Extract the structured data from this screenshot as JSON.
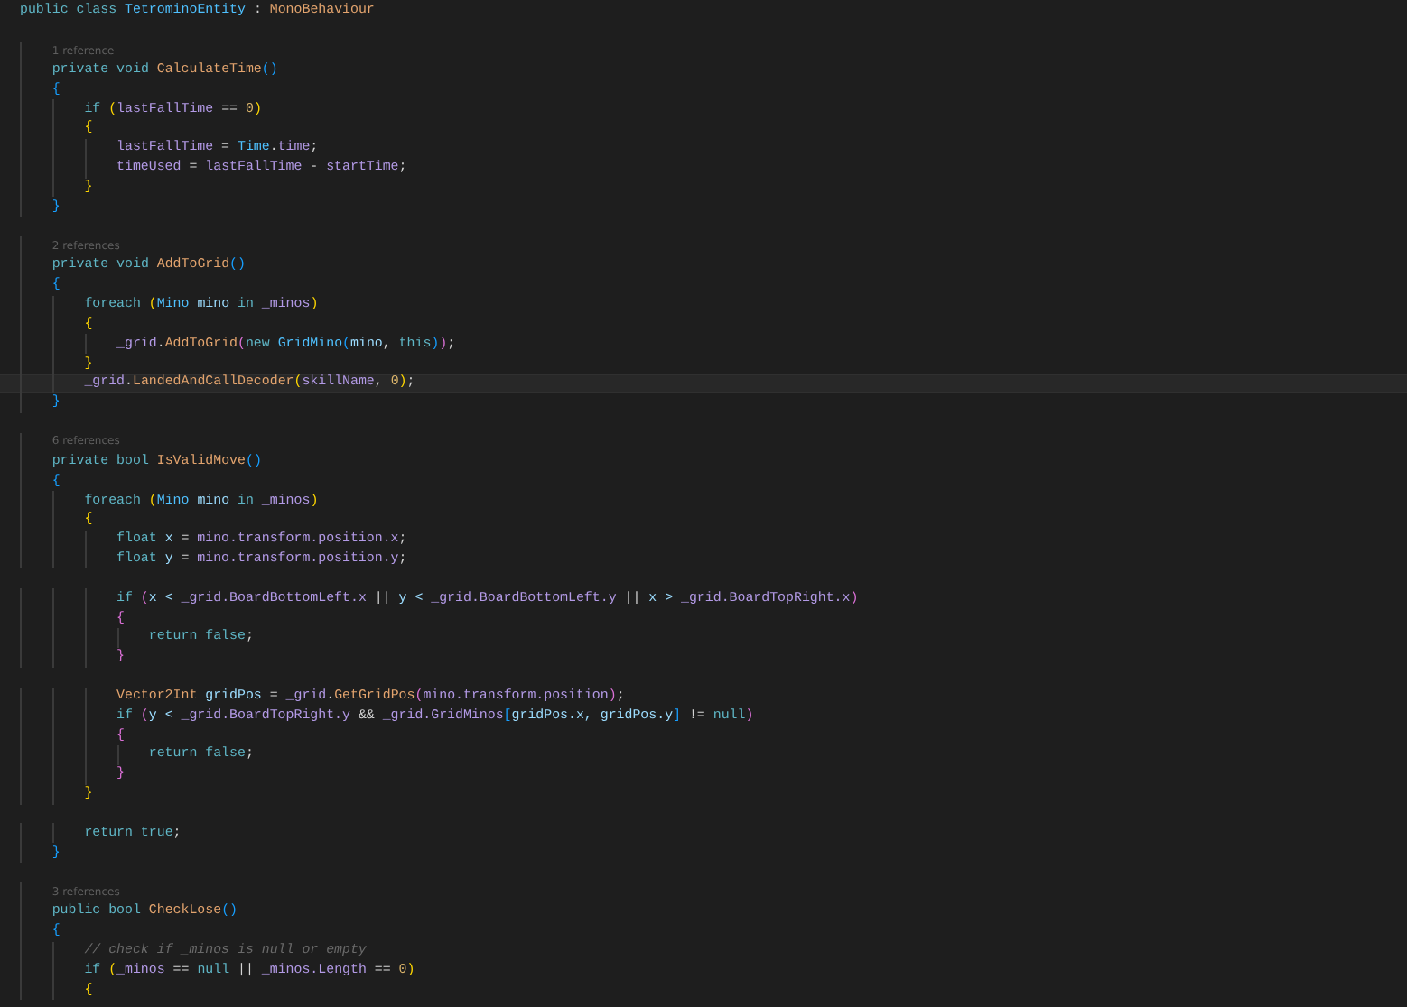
{
  "lines": [
    {
      "kind": "code",
      "tokens": [
        {
          "text": "public class ",
          "kind": "keyword"
        },
        {
          "text": "TetrominoEntity",
          "kind": "class"
        },
        {
          "text": " : ",
          "kind": "plain"
        },
        {
          "text": "MonoBehaviour",
          "kind": "base"
        }
      ],
      "children": [
        {
          "kind": "blank"
        },
        {
          "kind": "codelens",
          "text": "1 reference"
        },
        {
          "kind": "code",
          "tokens": [
            {
              "text": "private void ",
              "kind": "keyword"
            },
            {
              "text": "CalculateTime",
              "kind": "method"
            },
            {
              "text": "()",
              "kind": "bracket3"
            }
          ]
        },
        {
          "kind": "code",
          "tokens": [
            {
              "text": "{",
              "kind": "bracket3"
            }
          ],
          "children": [
            {
              "kind": "code",
              "tokens": [
                {
                  "text": "if ",
                  "kind": "keyword"
                },
                {
                  "text": "(",
                  "kind": "bracket1"
                },
                {
                  "text": "lastFallTime",
                  "kind": "field"
                },
                {
                  "text": " == ",
                  "kind": "plain"
                },
                {
                  "text": "0",
                  "kind": "number"
                },
                {
                  "text": ")",
                  "kind": "bracket1"
                }
              ]
            },
            {
              "kind": "code",
              "tokens": [
                {
                  "text": "{",
                  "kind": "bracket1"
                }
              ],
              "children": [
                {
                  "kind": "code",
                  "tokens": [
                    {
                      "text": "lastFallTime",
                      "kind": "field"
                    },
                    {
                      "text": " = ",
                      "kind": "plain"
                    },
                    {
                      "text": "Time",
                      "kind": "class"
                    },
                    {
                      "text": ".",
                      "kind": "plain"
                    },
                    {
                      "text": "time",
                      "kind": "field"
                    },
                    {
                      "text": ";",
                      "kind": "plain"
                    }
                  ]
                },
                {
                  "kind": "code",
                  "tokens": [
                    {
                      "text": "timeUsed",
                      "kind": "field"
                    },
                    {
                      "text": " = ",
                      "kind": "plain"
                    },
                    {
                      "text": "lastFallTime",
                      "kind": "field"
                    },
                    {
                      "text": " - ",
                      "kind": "plain"
                    },
                    {
                      "text": "startTime",
                      "kind": "field"
                    },
                    {
                      "text": ";",
                      "kind": "plain"
                    }
                  ]
                }
              ]
            },
            {
              "kind": "code",
              "tokens": [
                {
                  "text": "}",
                  "kind": "bracket1"
                }
              ]
            }
          ]
        },
        {
          "kind": "code",
          "tokens": [
            {
              "text": "}",
              "kind": "bracket3"
            }
          ]
        },
        {
          "kind": "blank"
        },
        {
          "kind": "codelens",
          "text": "2 references"
        },
        {
          "kind": "code",
          "tokens": [
            {
              "text": "private void ",
              "kind": "keyword"
            },
            {
              "text": "AddToGrid",
              "kind": "method"
            },
            {
              "text": "()",
              "kind": "bracket3"
            }
          ]
        },
        {
          "kind": "code",
          "tokens": [
            {
              "text": "{",
              "kind": "bracket3"
            }
          ],
          "children": [
            {
              "kind": "code",
              "tokens": [
                {
                  "text": "foreach ",
                  "kind": "keyword"
                },
                {
                  "text": "(",
                  "kind": "bracket1"
                },
                {
                  "text": "Mino",
                  "kind": "class"
                },
                {
                  "text": " mino ",
                  "kind": "local"
                },
                {
                  "text": "in ",
                  "kind": "keyword"
                },
                {
                  "text": "_minos",
                  "kind": "field"
                },
                {
                  "text": ")",
                  "kind": "bracket1"
                }
              ]
            },
            {
              "kind": "code",
              "tokens": [
                {
                  "text": "{",
                  "kind": "bracket1"
                }
              ],
              "children": [
                {
                  "kind": "code",
                  "tokens": [
                    {
                      "text": "_grid",
                      "kind": "field"
                    },
                    {
                      "text": ".",
                      "kind": "plain"
                    },
                    {
                      "text": "AddToGrid",
                      "kind": "method"
                    },
                    {
                      "text": "(",
                      "kind": "bracket2"
                    },
                    {
                      "text": "new ",
                      "kind": "keyword"
                    },
                    {
                      "text": "GridMino",
                      "kind": "class"
                    },
                    {
                      "text": "(",
                      "kind": "bracket3"
                    },
                    {
                      "text": "mino",
                      "kind": "local"
                    },
                    {
                      "text": ", ",
                      "kind": "plain"
                    },
                    {
                      "text": "this",
                      "kind": "keyword"
                    },
                    {
                      "text": ")",
                      "kind": "bracket3"
                    },
                    {
                      "text": ")",
                      "kind": "bracket2"
                    },
                    {
                      "text": ";",
                      "kind": "plain"
                    }
                  ]
                }
              ]
            },
            {
              "kind": "code",
              "tokens": [
                {
                  "text": "}",
                  "kind": "bracket1"
                }
              ]
            },
            {
              "kind": "code",
              "current": true,
              "tokens": [
                {
                  "text": "_grid",
                  "kind": "field"
                },
                {
                  "text": ".",
                  "kind": "plain"
                },
                {
                  "text": "LandedAndCallDecoder",
                  "kind": "method"
                },
                {
                  "text": "(",
                  "kind": "bracket1"
                },
                {
                  "text": "skillName",
                  "kind": "field"
                },
                {
                  "text": ", ",
                  "kind": "plain"
                },
                {
                  "text": "0",
                  "kind": "number"
                },
                {
                  "text": ")",
                  "kind": "bracket1"
                },
                {
                  "text": ";",
                  "kind": "plain"
                }
              ]
            }
          ]
        },
        {
          "kind": "code",
          "tokens": [
            {
              "text": "}",
              "kind": "bracket3"
            }
          ]
        },
        {
          "kind": "blank"
        },
        {
          "kind": "codelens",
          "text": "6 references"
        },
        {
          "kind": "code",
          "tokens": [
            {
              "text": "private bool ",
              "kind": "keyword"
            },
            {
              "text": "IsValidMove",
              "kind": "method"
            },
            {
              "text": "()",
              "kind": "bracket3"
            }
          ]
        },
        {
          "kind": "code",
          "tokens": [
            {
              "text": "{",
              "kind": "bracket3"
            }
          ],
          "children": [
            {
              "kind": "code",
              "tokens": [
                {
                  "text": "foreach ",
                  "kind": "keyword"
                },
                {
                  "text": "(",
                  "kind": "bracket1"
                },
                {
                  "text": "Mino",
                  "kind": "class"
                },
                {
                  "text": " mino ",
                  "kind": "local"
                },
                {
                  "text": "in ",
                  "kind": "keyword"
                },
                {
                  "text": "_minos",
                  "kind": "field"
                },
                {
                  "text": ")",
                  "kind": "bracket1"
                }
              ]
            },
            {
              "kind": "code",
              "tokens": [
                {
                  "text": "{",
                  "kind": "bracket1"
                }
              ],
              "children": [
                {
                  "kind": "code",
                  "tokens": [
                    {
                      "text": "float ",
                      "kind": "keyword"
                    },
                    {
                      "text": "x",
                      "kind": "local"
                    },
                    {
                      "text": " = ",
                      "kind": "plain"
                    },
                    {
                      "text": "mino.transform.position.x",
                      "kind": "field"
                    },
                    {
                      "text": ";",
                      "kind": "plain"
                    }
                  ]
                },
                {
                  "kind": "code",
                  "tokens": [
                    {
                      "text": "float ",
                      "kind": "keyword"
                    },
                    {
                      "text": "y",
                      "kind": "local"
                    },
                    {
                      "text": " = ",
                      "kind": "plain"
                    },
                    {
                      "text": "mino.transform.position.y",
                      "kind": "field"
                    },
                    {
                      "text": ";",
                      "kind": "plain"
                    }
                  ]
                },
                {
                  "kind": "blank"
                },
                {
                  "kind": "code",
                  "tokens": [
                    {
                      "text": "if ",
                      "kind": "keyword"
                    },
                    {
                      "text": "(",
                      "kind": "bracket2"
                    },
                    {
                      "text": "x < ",
                      "kind": "local"
                    },
                    {
                      "text": "_grid.BoardBottomLeft.x",
                      "kind": "field"
                    },
                    {
                      "text": " || ",
                      "kind": "plain"
                    },
                    {
                      "text": "y < ",
                      "kind": "local"
                    },
                    {
                      "text": "_grid.BoardBottomLeft.y",
                      "kind": "field"
                    },
                    {
                      "text": " || ",
                      "kind": "plain"
                    },
                    {
                      "text": "x > ",
                      "kind": "local"
                    },
                    {
                      "text": "_grid.BoardTopRight.x",
                      "kind": "field"
                    },
                    {
                      "text": ")",
                      "kind": "bracket2"
                    }
                  ]
                },
                {
                  "kind": "code",
                  "tokens": [
                    {
                      "text": "{",
                      "kind": "bracket2"
                    }
                  ],
                  "children": [
                    {
                      "kind": "code",
                      "tokens": [
                        {
                          "text": "return false",
                          "kind": "keyword"
                        },
                        {
                          "text": ";",
                          "kind": "plain"
                        }
                      ]
                    }
                  ]
                },
                {
                  "kind": "code",
                  "tokens": [
                    {
                      "text": "}",
                      "kind": "bracket2"
                    }
                  ]
                },
                {
                  "kind": "blank"
                },
                {
                  "kind": "code",
                  "tokens": [
                    {
                      "text": "Vector2Int",
                      "kind": "base"
                    },
                    {
                      "text": " gridPos",
                      "kind": "local"
                    },
                    {
                      "text": " = ",
                      "kind": "plain"
                    },
                    {
                      "text": "_grid",
                      "kind": "field"
                    },
                    {
                      "text": ".",
                      "kind": "plain"
                    },
                    {
                      "text": "GetGridPos",
                      "kind": "method"
                    },
                    {
                      "text": "(",
                      "kind": "bracket2"
                    },
                    {
                      "text": "mino.transform.position",
                      "kind": "field"
                    },
                    {
                      "text": ")",
                      "kind": "bracket2"
                    },
                    {
                      "text": ";",
                      "kind": "plain"
                    }
                  ]
                },
                {
                  "kind": "code",
                  "tokens": [
                    {
                      "text": "if ",
                      "kind": "keyword"
                    },
                    {
                      "text": "(",
                      "kind": "bracket2"
                    },
                    {
                      "text": "y < ",
                      "kind": "local"
                    },
                    {
                      "text": "_grid.BoardTopRight.y",
                      "kind": "field"
                    },
                    {
                      "text": " && ",
                      "kind": "plain"
                    },
                    {
                      "text": "_grid.GridMinos",
                      "kind": "field"
                    },
                    {
                      "text": "[",
                      "kind": "bracket3"
                    },
                    {
                      "text": "gridPos.x, gridPos.y",
                      "kind": "local"
                    },
                    {
                      "text": "]",
                      "kind": "bracket3"
                    },
                    {
                      "text": " != ",
                      "kind": "plain"
                    },
                    {
                      "text": "null",
                      "kind": "keyword"
                    },
                    {
                      "text": ")",
                      "kind": "bracket2"
                    }
                  ]
                },
                {
                  "kind": "code",
                  "tokens": [
                    {
                      "text": "{",
                      "kind": "bracket2"
                    }
                  ],
                  "children": [
                    {
                      "kind": "code",
                      "tokens": [
                        {
                          "text": "return false",
                          "kind": "keyword"
                        },
                        {
                          "text": ";",
                          "kind": "plain"
                        }
                      ]
                    }
                  ]
                },
                {
                  "kind": "code",
                  "tokens": [
                    {
                      "text": "}",
                      "kind": "bracket2"
                    }
                  ]
                }
              ]
            },
            {
              "kind": "code",
              "tokens": [
                {
                  "text": "}",
                  "kind": "bracket1"
                }
              ]
            },
            {
              "kind": "blank"
            },
            {
              "kind": "code",
              "tokens": [
                {
                  "text": "return true",
                  "kind": "keyword"
                },
                {
                  "text": ";",
                  "kind": "plain"
                }
              ]
            }
          ]
        },
        {
          "kind": "code",
          "tokens": [
            {
              "text": "}",
              "kind": "bracket3"
            }
          ]
        },
        {
          "kind": "blank"
        },
        {
          "kind": "codelens",
          "text": "3 references"
        },
        {
          "kind": "code",
          "tokens": [
            {
              "text": "public bool ",
              "kind": "keyword"
            },
            {
              "text": "CheckLose",
              "kind": "method"
            },
            {
              "text": "()",
              "kind": "bracket3"
            }
          ]
        },
        {
          "kind": "code",
          "tokens": [
            {
              "text": "{",
              "kind": "bracket3"
            }
          ],
          "children": [
            {
              "kind": "code",
              "tokens": [
                {
                  "text": "// check if _minos is null or empty",
                  "kind": "comment"
                }
              ]
            },
            {
              "kind": "code",
              "tokens": [
                {
                  "text": "if ",
                  "kind": "keyword"
                },
                {
                  "text": "(",
                  "kind": "bracket1"
                },
                {
                  "text": "_minos",
                  "kind": "field"
                },
                {
                  "text": " == ",
                  "kind": "plain"
                },
                {
                  "text": "null",
                  "kind": "keyword"
                },
                {
                  "text": " || ",
                  "kind": "plain"
                },
                {
                  "text": "_minos.Length",
                  "kind": "field"
                },
                {
                  "text": " == ",
                  "kind": "plain"
                },
                {
                  "text": "0",
                  "kind": "number"
                },
                {
                  "text": ")",
                  "kind": "bracket1"
                }
              ]
            },
            {
              "kind": "code",
              "tokens": [
                {
                  "text": "{",
                  "kind": "bracket1"
                }
              ]
            }
          ]
        }
      ]
    }
  ]
}
